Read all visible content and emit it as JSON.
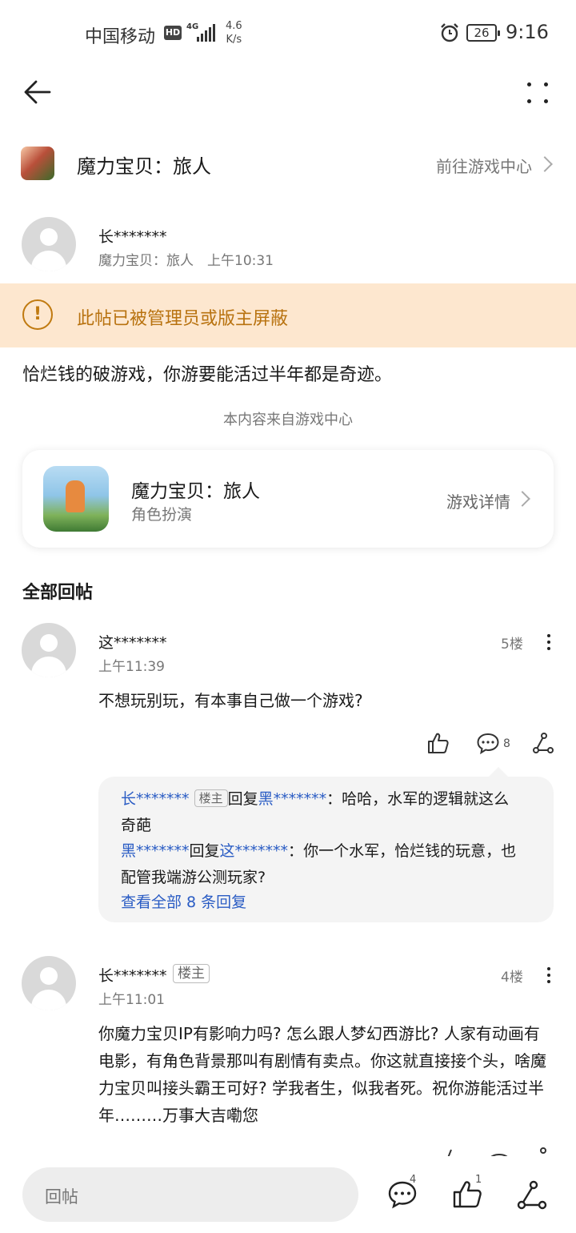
{
  "status_bar": {
    "carrier": "中国移动",
    "hd": "HD",
    "network": "4G",
    "speed_value": "4.6",
    "speed_unit": "K/s",
    "battery": "26",
    "time": "9:16"
  },
  "header": {
    "back_icon": "arrow-left-icon",
    "more_icon": "more-vertical-icon"
  },
  "game_row": {
    "title": "魔力宝贝：旅人",
    "link": "前往游戏中心"
  },
  "post": {
    "author": "长*******",
    "meta": "魔力宝贝：旅人　上午10:31",
    "notice": "此帖已被管理员或版主屏蔽",
    "body": "恰烂钱的破游戏，你游要能活过半年都是奇迹。",
    "source": "本内容来自游戏中心"
  },
  "game_card": {
    "title": "魔力宝贝：旅人",
    "genre": "角色扮演",
    "link": "游戏详情"
  },
  "replies_section": {
    "title": "全部回帖"
  },
  "replies": [
    {
      "author": "这*******",
      "time": "上午11:39",
      "floor": "5楼",
      "text": "不想玩别玩，有本事自己做一个游戏?",
      "comment_count": "8",
      "sub_replies": [
        {
          "from": "长*******",
          "from_tag": "楼主",
          "verb": "回复",
          "to": "黑*******",
          "colon": "：",
          "text_line1": "哈哈，水军的逻辑就这么",
          "text_line2": "奇葩"
        },
        {
          "from": "黑*******",
          "verb": "回复",
          "to": "这*******",
          "colon": "：",
          "text_line1": "你一个水军，恰烂钱的玩意，也",
          "text_line2": "配管我端游公测玩家?"
        }
      ],
      "view_all": "查看全部 8 条回复"
    },
    {
      "author": "长*******",
      "tag": "楼主",
      "time": "上午11:01",
      "floor": "4楼",
      "lines": [
        "你魔力宝贝IP有影响力吗? 怎么跟人梦幻西游比? 人家有动画有",
        "电影，有角色背景那叫有剧情有卖点。你这就直接接个头，啥魔",
        "力宝贝叫接头霸王可好? 学我者生，似我者死。祝你游能活过半",
        "年………万事大吉嘞您"
      ]
    }
  ],
  "bottom_bar": {
    "placeholder": "回帖",
    "comment_count": "4",
    "like_count": "1"
  },
  "colors": {
    "accent_blue": "#2a5cc4",
    "notice_bg": "#fde7cf",
    "notice_text": "#b8720f"
  }
}
